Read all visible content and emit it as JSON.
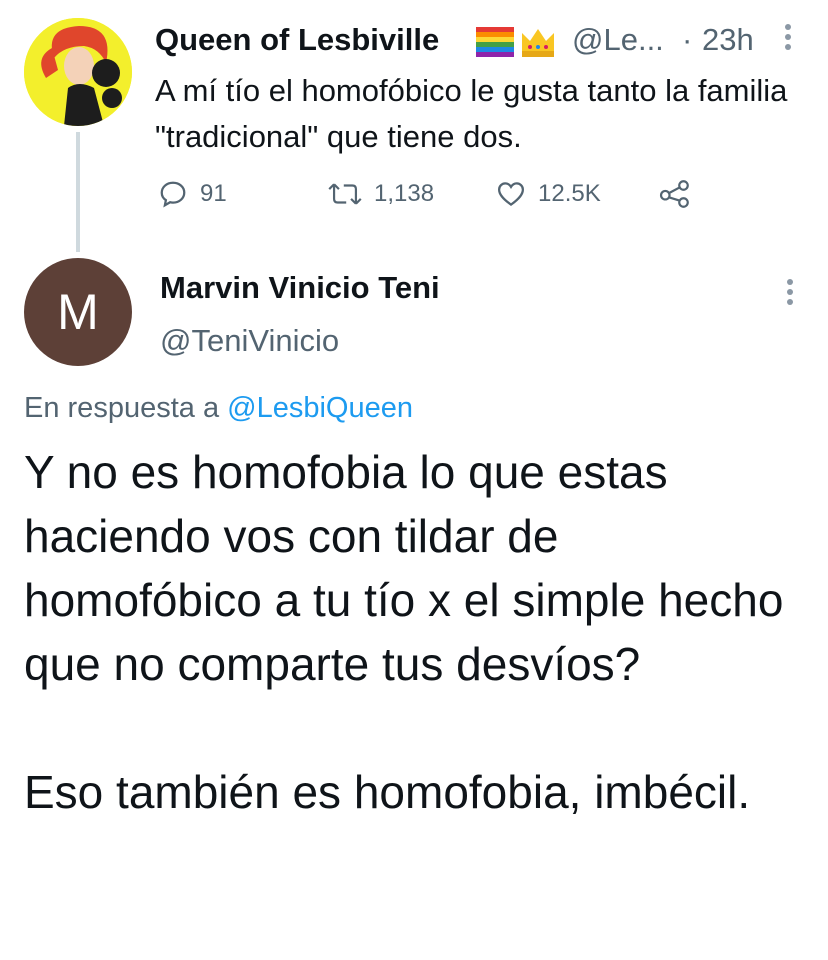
{
  "parent_tweet": {
    "name": "Queen of Lesbiville",
    "handle": "@Le...",
    "separator": "·",
    "time": "23h",
    "text": "A mí tío el homofóbico le gusta tanto la familia \"tradicional\" que tiene dos.",
    "stats": {
      "replies": "91",
      "retweets": "1,138",
      "likes": "12.5K"
    }
  },
  "reply_tweet": {
    "avatar_initial": "M",
    "name": "Marvin Vinicio Teni",
    "handle": "@TeniVinicio",
    "reply_prefix": "En respuesta a ",
    "reply_mention": "@LesbiQueen",
    "paragraph1": "Y no es homofobia lo que estas haciendo vos con tildar de homofóbico a tu tío x el simple hecho que no comparte tus desvíos?",
    "paragraph2": "Eso también es homofobia, imbécil."
  },
  "colors": {
    "text": "#0f1419",
    "secondary": "#536471",
    "link": "#1d9bf0",
    "avatar2_bg": "#5d4037",
    "thread_line": "#cfd9de"
  }
}
